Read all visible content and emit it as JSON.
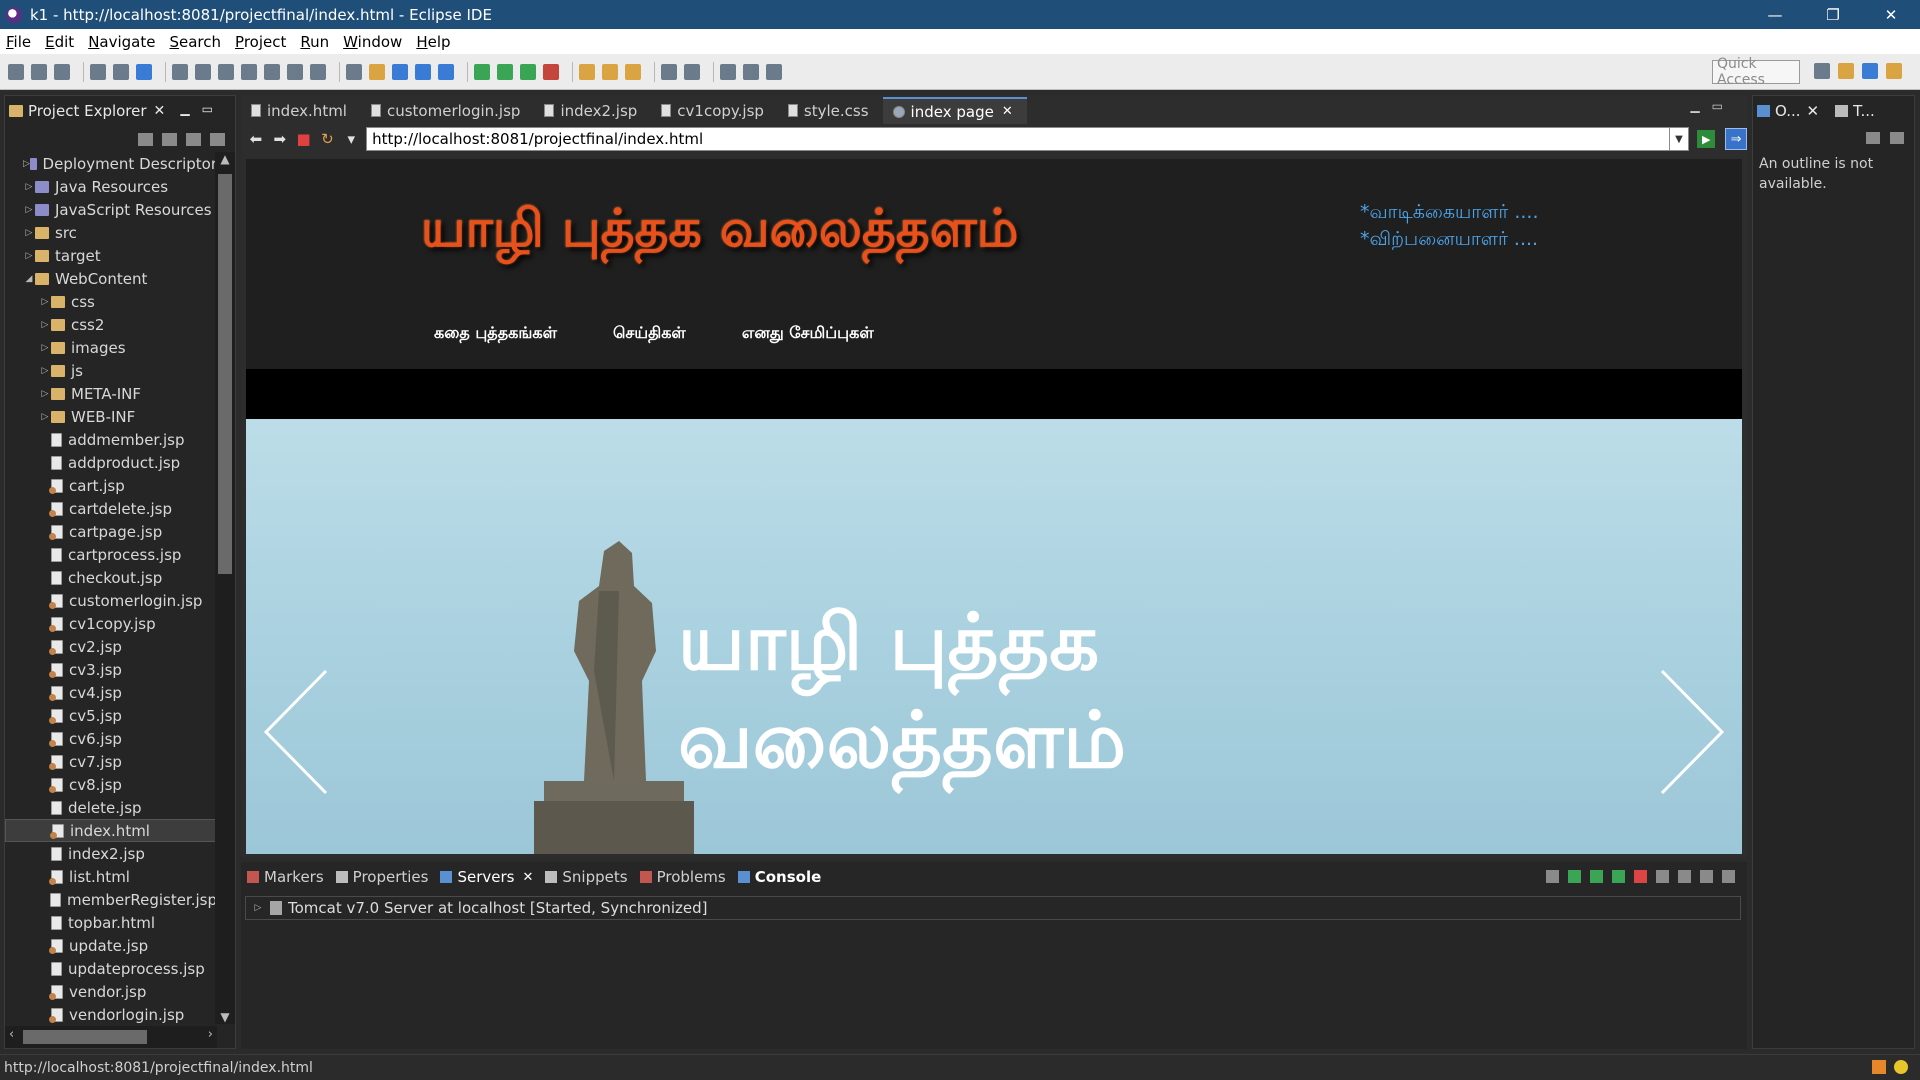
{
  "window": {
    "title": "k1 - http://localhost:8081/projectfinal/index.html - Eclipse IDE",
    "minimize": "—",
    "restore": "❐",
    "close": "✕"
  },
  "menu": [
    "File",
    "Edit",
    "Navigate",
    "Search",
    "Project",
    "Run",
    "Window",
    "Help"
  ],
  "toolbar": {
    "quick_access": "Quick Access"
  },
  "project_explorer": {
    "title": "Project Explorer",
    "items": [
      {
        "label": "Deployment Descriptor",
        "indent": 1,
        "type": "proj",
        "toggle": "▷"
      },
      {
        "label": "Java Resources",
        "indent": 1,
        "type": "proj",
        "toggle": "▷"
      },
      {
        "label": "JavaScript Resources",
        "indent": 1,
        "type": "proj",
        "toggle": "▷"
      },
      {
        "label": "src",
        "indent": 1,
        "type": "folder",
        "toggle": "▷"
      },
      {
        "label": "target",
        "indent": 1,
        "type": "folder",
        "toggle": "▷"
      },
      {
        "label": "WebContent",
        "indent": 1,
        "type": "folder",
        "toggle": "◢"
      },
      {
        "label": "css",
        "indent": 2,
        "type": "folder",
        "toggle": "▷"
      },
      {
        "label": "css2",
        "indent": 2,
        "type": "folder",
        "toggle": "▷"
      },
      {
        "label": "images",
        "indent": 2,
        "type": "folder",
        "toggle": "▷"
      },
      {
        "label": "js",
        "indent": 2,
        "type": "folder",
        "toggle": "▷"
      },
      {
        "label": "META-INF",
        "indent": 2,
        "type": "folder",
        "toggle": "▷"
      },
      {
        "label": "WEB-INF",
        "indent": 2,
        "type": "folder",
        "toggle": "▷"
      },
      {
        "label": "addmember.jsp",
        "indent": 2,
        "type": "page",
        "toggle": ""
      },
      {
        "label": "addproduct.jsp",
        "indent": 2,
        "type": "page",
        "toggle": ""
      },
      {
        "label": "cart.jsp",
        "indent": 2,
        "type": "jsp",
        "toggle": ""
      },
      {
        "label": "cartdelete.jsp",
        "indent": 2,
        "type": "jsp",
        "toggle": ""
      },
      {
        "label": "cartpage.jsp",
        "indent": 2,
        "type": "jsp",
        "toggle": ""
      },
      {
        "label": "cartprocess.jsp",
        "indent": 2,
        "type": "page",
        "toggle": ""
      },
      {
        "label": "checkout.jsp",
        "indent": 2,
        "type": "page",
        "toggle": ""
      },
      {
        "label": "customerlogin.jsp",
        "indent": 2,
        "type": "jsp",
        "toggle": ""
      },
      {
        "label": "cv1copy.jsp",
        "indent": 2,
        "type": "jsp",
        "toggle": ""
      },
      {
        "label": "cv2.jsp",
        "indent": 2,
        "type": "jsp",
        "toggle": ""
      },
      {
        "label": "cv3.jsp",
        "indent": 2,
        "type": "jsp",
        "toggle": ""
      },
      {
        "label": "cv4.jsp",
        "indent": 2,
        "type": "jsp",
        "toggle": ""
      },
      {
        "label": "cv5.jsp",
        "indent": 2,
        "type": "jsp",
        "toggle": ""
      },
      {
        "label": "cv6.jsp",
        "indent": 2,
        "type": "jsp",
        "toggle": ""
      },
      {
        "label": "cv7.jsp",
        "indent": 2,
        "type": "jsp",
        "toggle": ""
      },
      {
        "label": "cv8.jsp",
        "indent": 2,
        "type": "jsp",
        "toggle": ""
      },
      {
        "label": "delete.jsp",
        "indent": 2,
        "type": "page",
        "toggle": ""
      },
      {
        "label": "index.html",
        "indent": 2,
        "type": "jsp",
        "toggle": "",
        "selected": true
      },
      {
        "label": "index2.jsp",
        "indent": 2,
        "type": "page",
        "toggle": ""
      },
      {
        "label": "list.html",
        "indent": 2,
        "type": "jsp",
        "toggle": ""
      },
      {
        "label": "memberRegister.jsp",
        "indent": 2,
        "type": "page",
        "toggle": ""
      },
      {
        "label": "topbar.html",
        "indent": 2,
        "type": "page",
        "toggle": ""
      },
      {
        "label": "update.jsp",
        "indent": 2,
        "type": "jsp",
        "toggle": ""
      },
      {
        "label": "updateprocess.jsp",
        "indent": 2,
        "type": "page",
        "toggle": ""
      },
      {
        "label": "vendor.jsp",
        "indent": 2,
        "type": "jsp",
        "toggle": ""
      },
      {
        "label": "vendorlogin.jsp",
        "indent": 2,
        "type": "jsp",
        "toggle": ""
      }
    ]
  },
  "editor": {
    "tabs": [
      {
        "label": "index.html",
        "active": false
      },
      {
        "label": "customerlogin.jsp",
        "active": false
      },
      {
        "label": "index2.jsp",
        "active": false
      },
      {
        "label": "cv1copy.jsp",
        "active": false
      },
      {
        "label": "style.css",
        "active": false
      },
      {
        "label": "index page",
        "active": true
      }
    ],
    "url": "http://localhost:8081/projectfinal/index.html"
  },
  "site": {
    "logo": "யாழி புத்தக வலைத்தளம்",
    "login_links": [
      "*வாடிக்கையாளர் ....",
      "*விற்பனையாளர் ...."
    ],
    "nav": [
      "கதை புத்தகங்கள்",
      "செய்திகள்",
      "எனது சேமிப்புகள்"
    ],
    "hero_line1": "யாழி புத்தக",
    "hero_line2": "வலைத்தளம்"
  },
  "bottom_panel": {
    "tabs": [
      "Markers",
      "Properties",
      "Servers",
      "Snippets",
      "Problems",
      "Console"
    ],
    "server": "Tomcat v7.0 Server at localhost  [Started, Synchronized]"
  },
  "outline": {
    "title": "O...",
    "second_tab": "T...",
    "message": "An outline is not available."
  },
  "status": {
    "text": "http://localhost:8081/projectfinal/index.html"
  },
  "colors": {
    "accent": "#1f4e79",
    "logo": "#e8501c",
    "links": "#4da3e8"
  }
}
